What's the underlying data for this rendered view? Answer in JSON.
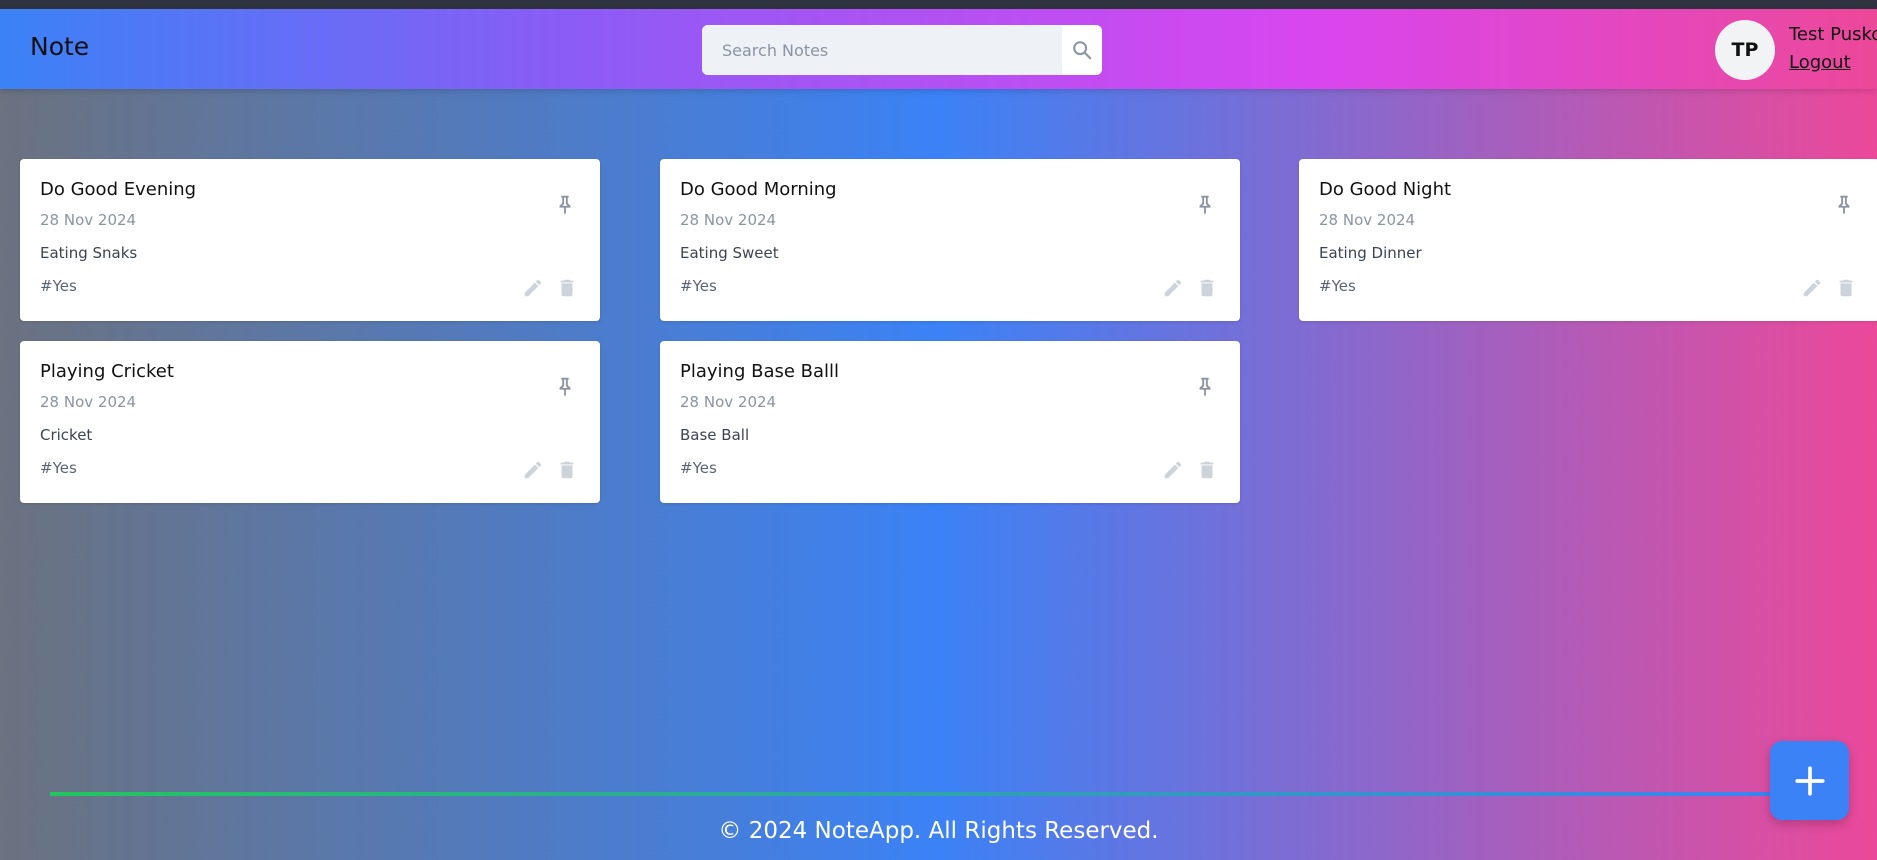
{
  "app": {
    "brand": "Note"
  },
  "search": {
    "placeholder": "Search Notes",
    "value": ""
  },
  "user": {
    "initials": "TP",
    "name": "Test Pusko",
    "logout_label": "Logout"
  },
  "notes": [
    {
      "title": "Do Good Evening",
      "date": "28 Nov 2024",
      "content": "Eating Snaks",
      "tags": "#Yes"
    },
    {
      "title": "Do Good Morning",
      "date": "28 Nov 2024",
      "content": "Eating Sweet",
      "tags": "#Yes"
    },
    {
      "title": "Do Good Night",
      "date": "28 Nov 2024",
      "content": "Eating Dinner",
      "tags": "#Yes"
    },
    {
      "title": "Playing Cricket",
      "date": "28 Nov 2024",
      "content": "Cricket",
      "tags": "#Yes"
    },
    {
      "title": "Playing Base Balll",
      "date": "28 Nov 2024",
      "content": "Base Ball",
      "tags": "#Yes"
    }
  ],
  "fab": {
    "icon": "plus-icon"
  },
  "footer": {
    "text": "© 2024 NoteApp. All Rights Reserved."
  },
  "colors": {
    "accent": "#3b82f6",
    "navbar_start": "#3b82f6",
    "navbar_end": "#ec4899",
    "progress_start": "#22c55e",
    "icon_gray": "#8a94a4"
  }
}
